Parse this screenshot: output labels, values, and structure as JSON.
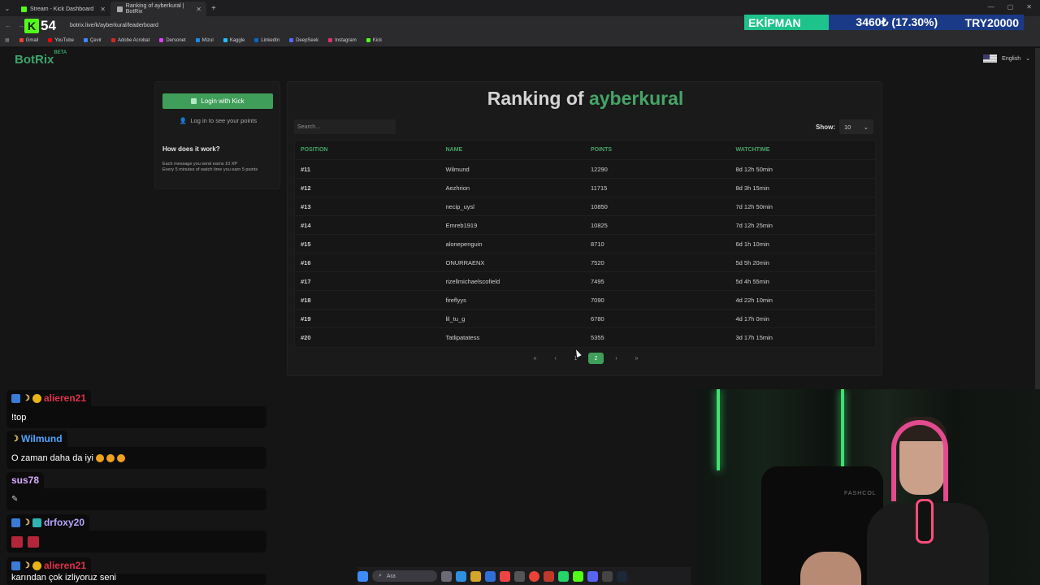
{
  "browser": {
    "tabs": [
      {
        "title": "Stream - Kick Dashboard",
        "active": false,
        "favicon_color": "#53fc18"
      },
      {
        "title": "Ranking of ayberkural | BotRix",
        "active": true,
        "favicon_color": "#aaaaaa"
      }
    ],
    "url": "botrix.live/k/ayberkural/leaderboard",
    "bookmarks": [
      {
        "label": "Gmail",
        "color": "#ea4335"
      },
      {
        "label": "YouTube",
        "color": "#ff0000"
      },
      {
        "label": "Çevir",
        "color": "#4285f4"
      },
      {
        "label": "Adobe Acrobat",
        "color": "#d7261d"
      },
      {
        "label": "Dersonet",
        "color": "#e040fb"
      },
      {
        "label": "Mizul",
        "color": "#1e88e5"
      },
      {
        "label": "Kaggle",
        "color": "#20beff"
      },
      {
        "label": "LinkedIn",
        "color": "#0a66c2"
      },
      {
        "label": "DeepSeek",
        "color": "#4d6bfe"
      },
      {
        "label": "Instagram",
        "color": "#e1306c"
      },
      {
        "label": "Kick",
        "color": "#53fc18"
      }
    ]
  },
  "overlay": {
    "kick_letter": "K",
    "kick_count": "54",
    "ticker_label": "EKİPMAN",
    "ticker_value": "3460₺ (17.30%)",
    "ticker_goal": "TRY20000"
  },
  "site": {
    "brand": "BotRix",
    "brand_sup": "BETA",
    "language": "English"
  },
  "sidebar": {
    "login_label": "Login with Kick",
    "see_points": "Log in to see your points",
    "how_title": "How does it work?",
    "how_line1": "Each message you send earns 10 XP",
    "how_line2": "Every 5 minutes of watch time you earn 5 points"
  },
  "leaderboard": {
    "title_prefix": "Ranking of",
    "channel": "ayberkural",
    "search_placeholder": "Search...",
    "show_label": "Show:",
    "show_value": "10",
    "columns": [
      "POSITION",
      "NAME",
      "POINTS",
      "WATCHTIME"
    ],
    "rows": [
      [
        "#11",
        "Wilmund",
        "12290",
        "8d 12h 50min"
      ],
      [
        "#12",
        "Aezhrion",
        "11715",
        "8d 3h 15min"
      ],
      [
        "#13",
        "necip_uysl",
        "10850",
        "7d 12h 50min"
      ],
      [
        "#14",
        "Emreb1919",
        "10825",
        "7d 12h 25min"
      ],
      [
        "#15",
        "alonepenguin",
        "8710",
        "6d 1h 10min"
      ],
      [
        "#16",
        "ONURRAENX",
        "7520",
        "5d 5h 20min"
      ],
      [
        "#17",
        "rizellmichaelscofield",
        "7495",
        "5d 4h 55min"
      ],
      [
        "#18",
        "fireflyys",
        "7090",
        "4d 22h 10min"
      ],
      [
        "#19",
        "lil_tu_g",
        "6780",
        "4d 17h 0min"
      ],
      [
        "#20",
        "Tatlipatatess",
        "5355",
        "3d 17h 15min"
      ]
    ],
    "pagination": {
      "first": "«",
      "prev": "‹",
      "page1": "1",
      "page2": "2",
      "next": "›",
      "last": "»"
    }
  },
  "chat": [
    {
      "user": "alieren21",
      "user_color": "#e0314a",
      "text": "!top"
    },
    {
      "user": "Wilmund",
      "user_color": "#4fa3ff",
      "text": "O zaman daha da iyi"
    },
    {
      "user": "sus78",
      "user_color": "#d9a8ff",
      "text": ""
    },
    {
      "user": "drfoxy20",
      "user_color": "#b9a6ff",
      "text": ""
    },
    {
      "user": "alieren21",
      "user_color": "#e0314a",
      "text": "karından çok izliyoruz seni"
    }
  ],
  "webcam": {
    "chair_text": "FASHCOL"
  },
  "taskbar": {
    "search_label": "Ara"
  }
}
